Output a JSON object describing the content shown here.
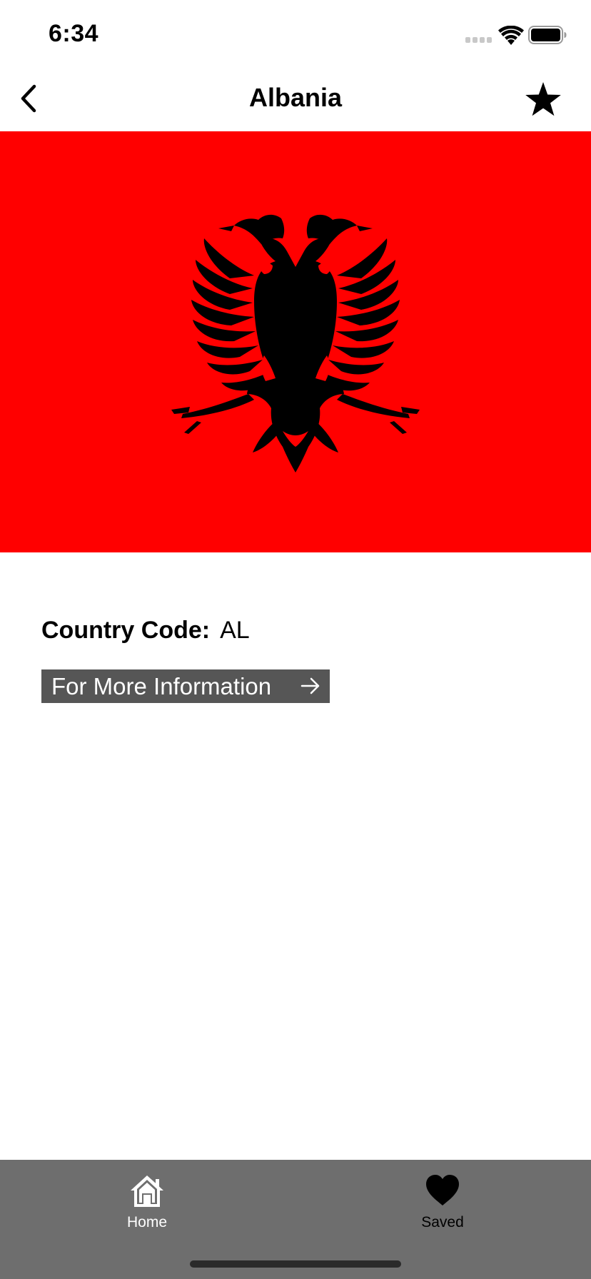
{
  "status_bar": {
    "time": "6:34",
    "icons": [
      "signal-icon",
      "wifi-icon",
      "battery-icon"
    ]
  },
  "nav": {
    "title": "Albania",
    "back_icon": "chevron-left-icon",
    "favorite_icon": "star-icon"
  },
  "flag": {
    "country": "Albania",
    "background_color": "#ff0000",
    "emblem_color": "#000000",
    "emblem": "double-headed-eagle"
  },
  "details": {
    "country_code_label": "Country Code:",
    "country_code_value": "AL",
    "more_info_label": "For More Information",
    "more_info_icon": "arrow-right-icon"
  },
  "tab_bar": {
    "background_color": "#6e6e6e",
    "tabs": [
      {
        "label": "Home",
        "icon": "home-icon",
        "active": true
      },
      {
        "label": "Saved",
        "icon": "heart-icon",
        "active": false
      }
    ]
  }
}
